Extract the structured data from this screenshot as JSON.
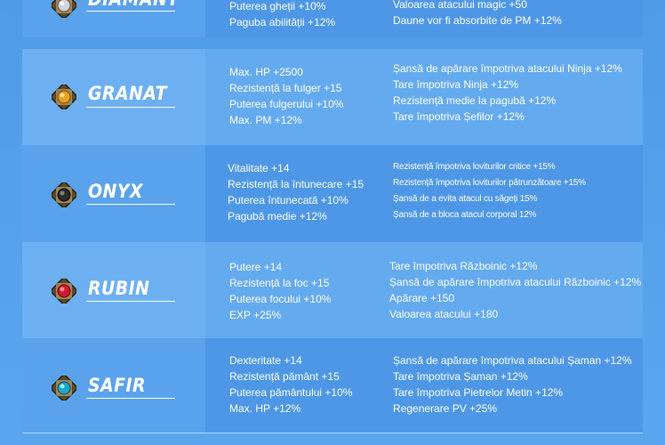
{
  "gems": [
    {
      "name": "DIAMANT",
      "icon": "diamond-gem-icon",
      "color": "#c9ccd4",
      "left_stats": [
        "Puterea gheții +10%",
        "Paguba abilității +12%"
      ],
      "right_stats": [
        "Valoarea atacului magic +50",
        "Daune vor fi absorbite de PM +12%"
      ]
    },
    {
      "name": "GRANAT",
      "icon": "garnet-gem-icon",
      "color": "#e8a21e",
      "left_stats": [
        "Max. HP +2500",
        "Rezistență la fulger +15",
        "Puterea fulgerului +10%",
        "Max. PM +12%"
      ],
      "right_stats": [
        "Șansă de apărare împotriva atacului Ninja +12%",
        "Tare împotriva Ninja +12%",
        "Rezistență medie la pagubă +12%",
        "Tare împotriva Șefilor +12%"
      ]
    },
    {
      "name": "ONYX",
      "icon": "onyx-gem-icon",
      "color": "#2b2b2b",
      "left_stats": [
        "Vitalitate +14",
        "Rezistență la întunecare +15",
        "Puterea întunecată +10%",
        "Pagubă medie +12%"
      ],
      "right_stats": [
        "Rezistență împotriva loviturilor critice +15%",
        "Rezistență împotriva loviturilor pătrunzătoare +15%",
        "Șansă de a evita atacul cu săgeți 15%",
        "Șansă de a bloca atacul corporal 12%"
      ]
    },
    {
      "name": "RUBIN",
      "icon": "ruby-gem-icon",
      "color": "#d11a2a",
      "left_stats": [
        "Putere +14",
        "Rezistență la foc +15",
        "Puterea focului +10%",
        "EXP +25%"
      ],
      "right_stats": [
        "Tare împotriva Războinic +12%",
        "Șansă de apărare împotriva atacului Războinic +12%",
        "Apărare +150",
        "Valoarea atacului +180"
      ]
    },
    {
      "name": "SAFIR",
      "icon": "sapphire-gem-icon",
      "color": "#1ba8c8",
      "left_stats": [
        "Dexteritate +14",
        "Rezistență pământ +15",
        "Puterea pământului +10%",
        "Max. HP +12%"
      ],
      "right_stats": [
        "Șansă de apărare împotriva atacului Șaman +12%",
        "Tare împotriva Șaman +12%",
        "Tare împotriva Pietrelor Metin +12%",
        "Regenerare PV +25%"
      ]
    }
  ]
}
